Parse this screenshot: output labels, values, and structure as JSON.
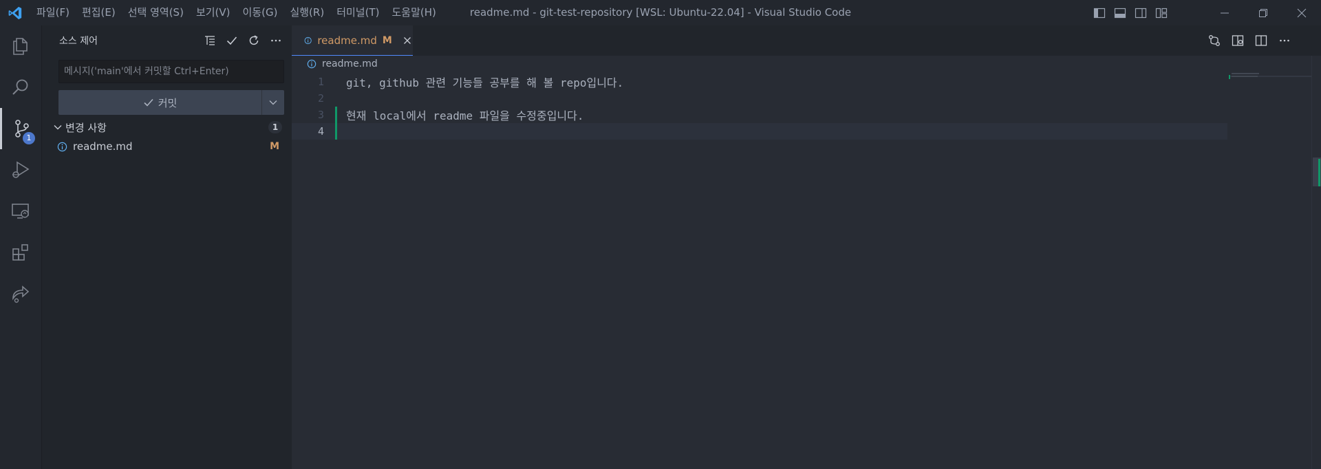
{
  "window": {
    "title": "readme.md - git-test-repository [WSL: Ubuntu-22.04] - Visual Studio Code"
  },
  "menu": [
    {
      "label": "파일(F)"
    },
    {
      "label": "편집(E)"
    },
    {
      "label": "선택 영역(S)"
    },
    {
      "label": "보기(V)"
    },
    {
      "label": "이동(G)"
    },
    {
      "label": "실행(R)"
    },
    {
      "label": "터미널(T)"
    },
    {
      "label": "도움말(H)"
    }
  ],
  "activity": {
    "scm_badge": "1"
  },
  "sidebar": {
    "title": "소스 제어",
    "commit_placeholder": "메시지('main'에서 커밋할 Ctrl+Enter)",
    "commit_label": "커밋",
    "changes_label": "변경 사항",
    "changes_count": "1",
    "files": [
      {
        "name": "readme.md",
        "status": "M"
      }
    ]
  },
  "editor": {
    "tab": {
      "name": "readme.md",
      "status": "M"
    },
    "breadcrumb": "readme.md",
    "lines": [
      {
        "num": "1",
        "text": "git, github 관련 기능들 공부를 해 볼 repo입니다."
      },
      {
        "num": "2",
        "text": ""
      },
      {
        "num": "3",
        "text": "현재 local에서 readme 파일을 수정중입니다."
      },
      {
        "num": "4",
        "text": ""
      }
    ]
  },
  "colors": {
    "accent": "#528bff",
    "modified": "#d19a66",
    "added": "#109868",
    "badge": "#4d78cc"
  }
}
